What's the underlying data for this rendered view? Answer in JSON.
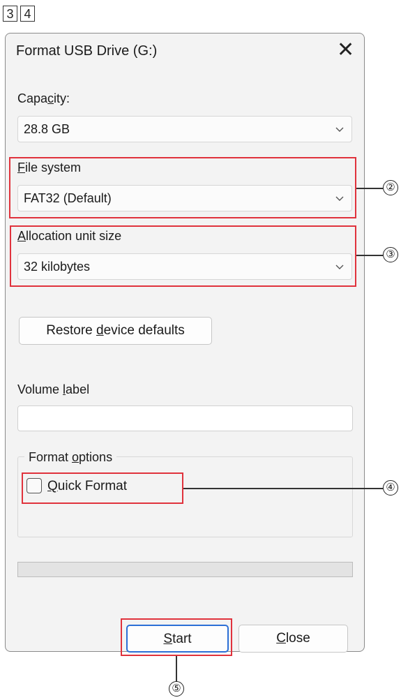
{
  "step_markers": [
    "3",
    "4"
  ],
  "dialog": {
    "title": "Format USB Drive (G:)",
    "close_glyph": "✕"
  },
  "capacity": {
    "label_pre": "Capa",
    "label_u": "c",
    "label_post": "ity:",
    "value": "28.8 GB"
  },
  "file_system": {
    "label_u": "F",
    "label_post": "ile system",
    "value": "FAT32 (Default)"
  },
  "allocation": {
    "label_u": "A",
    "label_post": "llocation unit size",
    "value": "32 kilobytes"
  },
  "restore_button": {
    "pre": "Restore ",
    "u": "d",
    "post": "evice defaults"
  },
  "volume_label": {
    "label_pre": "Volume ",
    "label_u": "l",
    "label_post": "abel",
    "value": ""
  },
  "format_options": {
    "legend_pre": "Format ",
    "legend_u": "o",
    "legend_post": "ptions",
    "quick_format": {
      "u": "Q",
      "post": "uick Format",
      "checked": false
    }
  },
  "progress": {
    "value": 0
  },
  "buttons": {
    "start": {
      "u": "S",
      "post": "tart"
    },
    "close": {
      "u": "C",
      "post": "lose"
    }
  },
  "callouts": [
    "②",
    "③",
    "④",
    "⑤"
  ],
  "colors": {
    "highlight": "#e0323c",
    "dialog_bg": "#f3f3f3"
  }
}
